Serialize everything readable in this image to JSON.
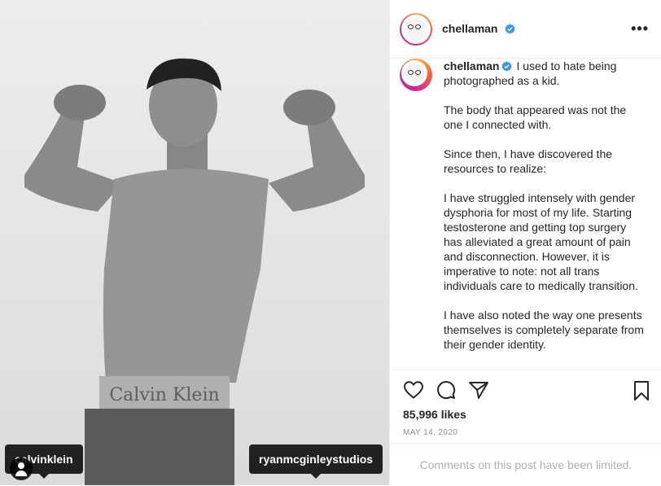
{
  "post": {
    "username": "chellaman",
    "tags": {
      "brand": "calvinklein",
      "photographer": "ryanmcginleystudios"
    },
    "waistband_text": "Calvin Klein"
  },
  "caption": {
    "username": "chellaman",
    "paragraphs": [
      "I used to hate being photographed as a kid.",
      "The body that appeared was not the one I connected with.",
      "Since then, I have discovered the resources to realize:",
      "I have struggled intensely with gender dysphoria for most of my life. Starting testosterone and getting top surgery has alleviated a great amount of pain and disconnection. However, it is imperative to note: not all trans individuals care to medically transition.",
      "I have also noted the way one presents themselves is completely separate from their gender identity."
    ]
  },
  "engagement": {
    "likes": "85,996 likes",
    "date": "MAY 14, 2020",
    "comments_notice": "Comments on this post have been limited."
  },
  "icons": [
    "more-icon",
    "verified-icon",
    "heart-icon",
    "comment-icon",
    "share-icon",
    "bookmark-icon",
    "user-tag-icon"
  ],
  "colors": {
    "verified": "#3897f0",
    "muted": "#8e8e8e",
    "text": "#262626",
    "border": "#efefef"
  }
}
